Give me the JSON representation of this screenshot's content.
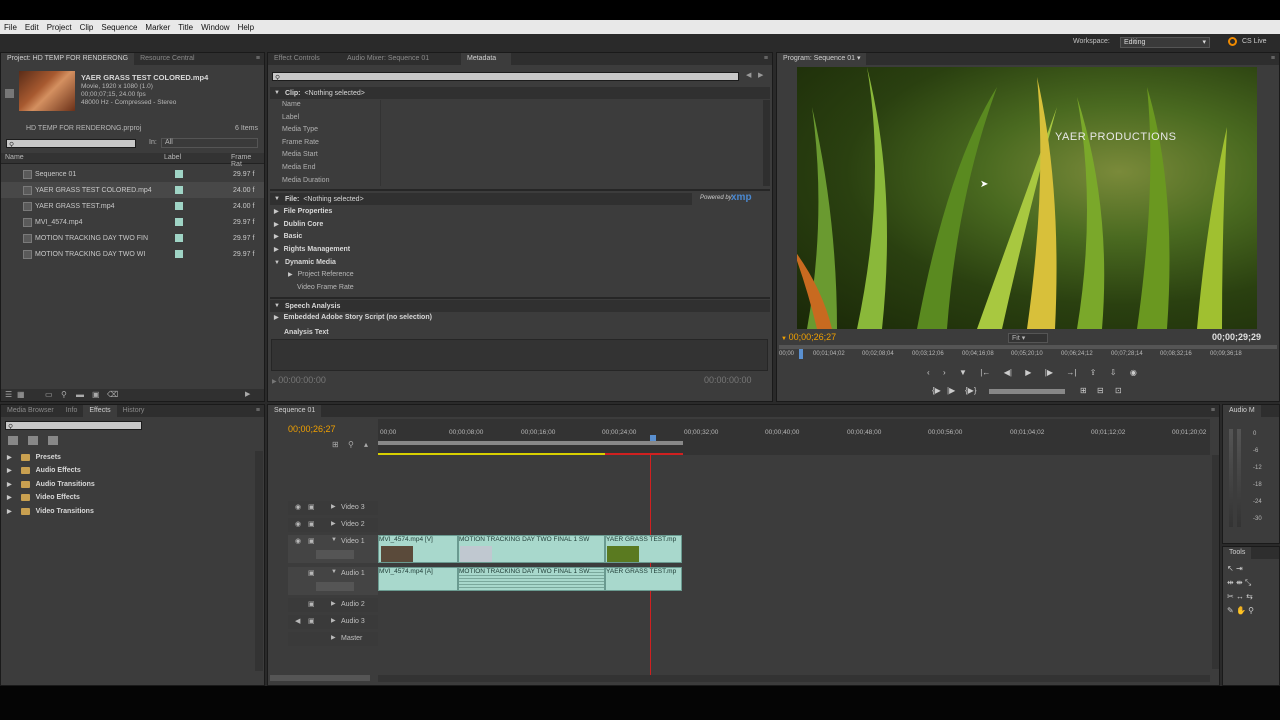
{
  "menubar": [
    "File",
    "Edit",
    "Project",
    "Clip",
    "Sequence",
    "Marker",
    "Title",
    "Window",
    "Help"
  ],
  "workspace": {
    "label": "Workspace:",
    "value": "Editing",
    "cslive": "CS Live"
  },
  "project": {
    "tabs": [
      "Project: HD TEMP FOR RENDERONG",
      "Resource Central"
    ],
    "preview": {
      "name": "YAER GRASS TEST COLORED.mp4",
      "type": "Movie, 1920 x 1080 (1.0)",
      "duration": "00;00;07;15, 24.00 fps",
      "audio": "48000 Hz - Compressed - Stereo"
    },
    "file": "HD TEMP FOR RENDERONG.prproj",
    "count": "6 Items",
    "in_label": "In:",
    "in_value": "All",
    "columns": [
      "Name",
      "Label",
      "Frame Rat"
    ],
    "items": [
      {
        "name": "Sequence 01",
        "rate": "29.97 f"
      },
      {
        "name": "YAER GRASS TEST COLORED.mp4",
        "rate": "24.00 f"
      },
      {
        "name": "YAER GRASS TEST.mp4",
        "rate": "24.00 f"
      },
      {
        "name": "MVI_4574.mp4",
        "rate": "29.97 f"
      },
      {
        "name": "MOTION TRACKING DAY TWO FIN",
        "rate": "29.97 f"
      },
      {
        "name": "MOTION TRACKING DAY TWO WI",
        "rate": "29.97 f"
      }
    ]
  },
  "metadata": {
    "tabs": [
      "Effect Controls",
      "Audio Mixer: Sequence 01",
      "Metadata"
    ],
    "clip_hdr": "Clip:",
    "clip_val": "<Nothing selected>",
    "fields": [
      "Name",
      "Label",
      "Media Type",
      "Frame Rate",
      "Media Start",
      "Media End",
      "Media Duration"
    ],
    "powered": "Powered by",
    "xmp": "xmp",
    "file_hdr": "File:",
    "file_val": "<Nothing selected>",
    "sections": [
      "File Properties",
      "Dublin Core",
      "Basic",
      "Rights Management",
      "Dynamic Media"
    ],
    "sub": [
      "Project Reference",
      "Video Frame Rate"
    ],
    "speech": "Speech Analysis",
    "story": "Embedded Adobe Story Script (no selection)",
    "analysis": "Analysis Text",
    "tc_left": "00:00:00:00",
    "tc_right": "00:00:00:00"
  },
  "program": {
    "tab": "Program: Sequence 01",
    "overlay": "YAER PRODUCTIONS",
    "tc_current": "00;00;26;27",
    "fit": "Fit",
    "tc_total": "00;00;29;29",
    "ruler": [
      "00;00",
      "00;01;04;02",
      "00;02;08;04",
      "00;03;12;06",
      "00;04;16;08",
      "00;05;20;10",
      "00;06;24;12",
      "00;07;28;14",
      "00;08;32;16",
      "00;09;36;18"
    ]
  },
  "effects": {
    "tabs": [
      "Media Browser",
      "Info",
      "Effects",
      "History"
    ],
    "items": [
      "Presets",
      "Audio Effects",
      "Audio Transitions",
      "Video Effects",
      "Video Transitions"
    ]
  },
  "timeline": {
    "tab": "Sequence 01",
    "tc": "00;00;26;27",
    "ruler": [
      "00;00",
      "00;00;08;00",
      "00;00;16;00",
      "00;00;24;00",
      "00;00;32;00",
      "00;00;40;00",
      "00;00;48;00",
      "00;00;56;00",
      "00;01;04;02",
      "00;01;12;02",
      "00;01;20;02"
    ],
    "tracks": [
      "Video 3",
      "Video 2",
      "Video 1",
      "Audio 1",
      "Audio 2",
      "Audio 3",
      "Master"
    ],
    "vclips": [
      "MVI_4574.mp4 [V]",
      "MOTION TRACKING DAY TWO FINAL 1 SW",
      "YAER GRASS TEST.mp"
    ],
    "aclips": [
      "MVI_4574.mp4 [A]",
      "MOTION TRACKING DAY TWO FINAL 1 SW",
      "YAER GRASS TEST.mp"
    ]
  },
  "audio_meter": {
    "label": "Audio M",
    "scale": [
      "0",
      "-6",
      "-12",
      "-18",
      "-24",
      "-30"
    ]
  },
  "tools": {
    "label": "Tools"
  }
}
